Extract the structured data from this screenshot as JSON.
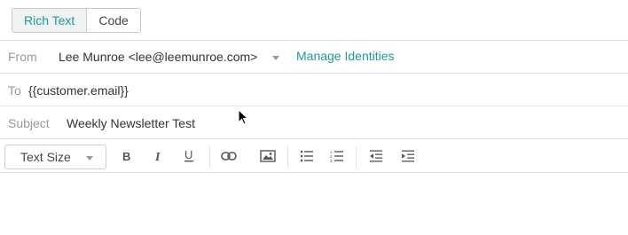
{
  "mode_toggle": {
    "rich_text_label": "Rich Text",
    "code_label": "Code",
    "active": "Rich Text"
  },
  "from": {
    "label": "From",
    "value": "Lee Munroe <lee@leemunroe.com>",
    "manage_label": "Manage Identities"
  },
  "to": {
    "label": "To",
    "value": "{{customer.email}}"
  },
  "subject": {
    "label": "Subject",
    "value": "Weekly Newsletter Test"
  },
  "toolbar": {
    "text_size_label": "Text Size",
    "buttons": [
      "bold",
      "italic",
      "underline",
      "link",
      "image",
      "bulleted-list",
      "numbered-list",
      "outdent",
      "indent"
    ]
  },
  "colors": {
    "accent": "#1f9a94",
    "label_gray": "#9a9a9a",
    "border": "#e4e4e4"
  }
}
